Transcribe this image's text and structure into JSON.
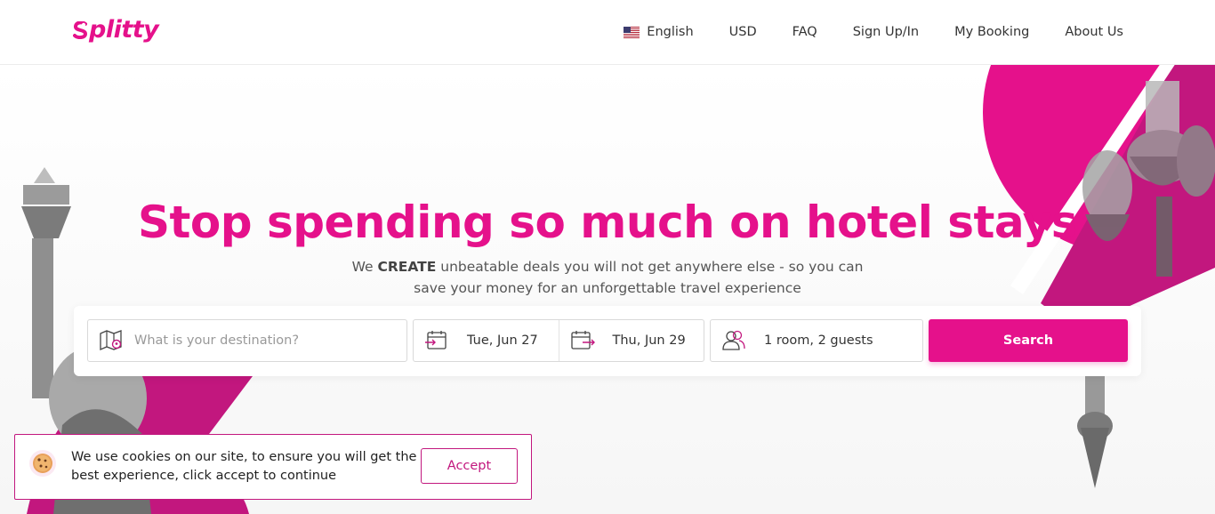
{
  "brand": {
    "name": "Splitty",
    "logo_text": "plitty",
    "accent": "#e5118b",
    "deco_pink": "#c2177e"
  },
  "nav": {
    "language_label": "English",
    "language_flag": "us-flag-icon",
    "currency_label": "USD",
    "faq_label": "FAQ",
    "signup_label": "Sign Up/In",
    "booking_label": "My Booking",
    "about_label": "About Us"
  },
  "hero": {
    "headline": "Stop spending so much on hotel stays",
    "sub_prefix": "We ",
    "sub_emphasis": "CREATE",
    "sub_rest": " unbeatable deals you will not get anywhere else - so you can save your money for an unforgettable travel experience"
  },
  "search": {
    "destination_placeholder": "What is your destination?",
    "destination_icon": "map-pin-icon",
    "checkin_value": "Tue, Jun 27",
    "checkin_icon": "calendar-checkin-icon",
    "checkout_value": "Thu, Jun 29",
    "checkout_icon": "calendar-checkout-icon",
    "guests_value": "1 room, 2 guests",
    "guests_icon": "guests-icon",
    "button_label": "Search"
  },
  "cookie": {
    "message": "We use cookies on our site, to ensure you will get the best experience, click accept to continue",
    "accept_label": "Accept",
    "icon": "cookie-icon"
  }
}
